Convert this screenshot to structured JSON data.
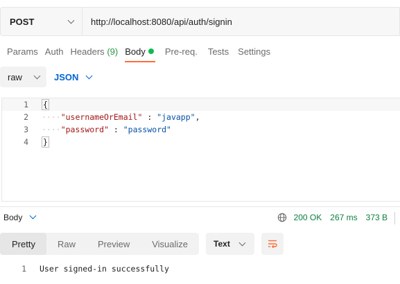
{
  "request": {
    "method": "POST",
    "url": "http://localhost:8080/api/auth/signin"
  },
  "request_tabs": [
    {
      "label": "Params"
    },
    {
      "label": "Auth"
    },
    {
      "label": "Headers",
      "count": "(9)"
    },
    {
      "label": "Body",
      "active": true
    },
    {
      "label": "Pre-req."
    },
    {
      "label": "Tests"
    },
    {
      "label": "Settings"
    }
  ],
  "body_options": {
    "mode": "raw",
    "language": "JSON"
  },
  "editor": {
    "lines": [
      {
        "number": "1",
        "open": "{"
      },
      {
        "number": "2",
        "key": "\"usernameOrEmail\"",
        "sep": " : ",
        "value": "\"javapp\"",
        "trail": ","
      },
      {
        "number": "3",
        "key": "\"password\"",
        "sep": " : ",
        "value": "\"password\"",
        "trail": ""
      },
      {
        "number": "4",
        "close": "}"
      }
    ]
  },
  "response": {
    "section_label": "Body",
    "status": "200 OK",
    "time": "267 ms",
    "size": "373 B",
    "view_tabs": [
      "Pretty",
      "Raw",
      "Preview",
      "Visualize"
    ],
    "active_view": "Pretty",
    "format": "Text",
    "lines": [
      {
        "number": "1",
        "text": "User signed-in successfully"
      }
    ]
  },
  "colors": {
    "accent": "#ff6c37",
    "link_blue": "#0265d2",
    "status_green": "#0a7f3f",
    "dot_green": "#0cbb52"
  },
  "icons": [
    "chevron-down-icon",
    "globe-icon",
    "wrap-lines-icon"
  ]
}
